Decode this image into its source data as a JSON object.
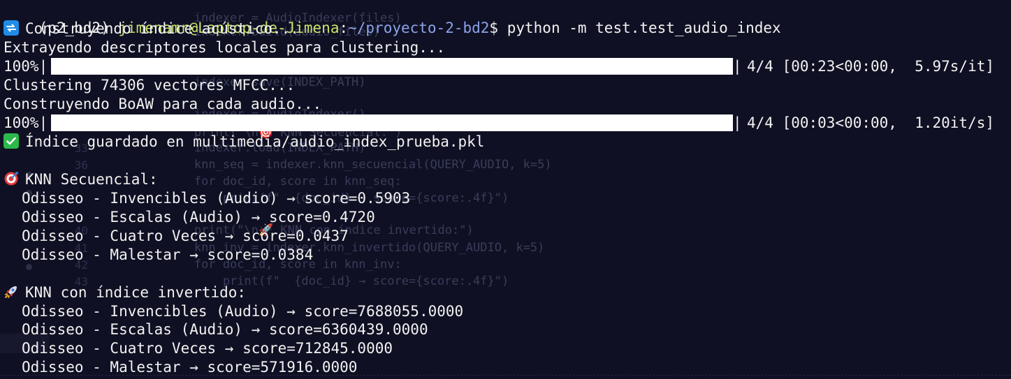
{
  "prompt": {
    "env": "(p2_bd2)",
    "user_host": "jimenamr@Laptop-de-Jimena",
    "colon": ":",
    "path": "~/proyecto-2-bd2",
    "dollar": "$",
    "command": "python -m test.test_audio_index"
  },
  "output": {
    "building_icon": "arrows-cycle-icon",
    "building_text": "Construyendo índice acústico...",
    "extracting_text": "Extrayendo descriptores locales para clustering...",
    "progress_1": {
      "percent_label": "100%|",
      "fraction": 1.0,
      "end_bar": "|",
      "stats": "4/4 [00:23<00:00,  5.97s/it]"
    },
    "clustering_text": "Clustering 74306 vectores MFCC...",
    "boaw_text": "Construyendo BoAW para cada audio...",
    "progress_2": {
      "percent_label": "100%|",
      "fraction": 1.0,
      "end_bar": "|",
      "stats": "4/4 [00:03<00:00,  1.20it/s]"
    },
    "saved_icon": "check-mark-icon",
    "saved_text": "Índice guardado en multimedia/audio_index_prueba.pkl",
    "knn_seq_icon": "target-icon",
    "knn_seq_title": "KNN Secuencial:",
    "knn_seq_results": [
      "Odisseo - Invencibles (Audio) → score=0.5903",
      "Odisseo - Escalas (Audio) → score=0.4720",
      "Odisseo - Cuatro Veces → score=0.0437",
      "Odisseo - Malestar → score=0.0384"
    ],
    "knn_inv_icon": "rocket-icon",
    "knn_inv_title": "KNN con índice invertido:",
    "knn_inv_results": [
      "Odisseo - Invencibles (Audio) → score=7688055.0000",
      "Odisseo - Escalas (Audio) → score=6360439.0000",
      "Odisseo - Cuatro Veces → score=712845.0000",
      "Odisseo - Malestar → score=571916.0000"
    ]
  },
  "ghost": {
    "lines": [
      {
        "num": "",
        "text": "        indexer = AudioIndexer(files)"
      },
      {
        "num": "",
        "text": "        indexer.build(audio_files)"
      },
      {
        "num": "",
        "text": "        indexer.save(INDEX_PATH)"
      },
      {
        "num": "",
        "text": "        indexer = AudioIndexer()"
      },
      {
        "num": "",
        "text": "        print(\"\\n🎯 KNN Secuencial:\")"
      },
      {
        "num": "33",
        "text": "        indexer.load(INDEX_PATH)"
      },
      {
        "num": "36",
        "text": "        knn_seq = indexer.knn_secuencial(QUERY_AUDIO, k=5)"
      },
      {
        "num": "",
        "text": "        for doc_id, score in knn_seq:"
      },
      {
        "num": "",
        "text": "            print(f\"  {doc_id} → score={score:.4f}\")"
      },
      {
        "num": "40",
        "text": "        print(\"\\n🚀 KNN con índice invertido:\")"
      },
      {
        "num": "41",
        "text": "        knn_inv = indexer.knn_invertido(QUERY_AUDIO, k=5)"
      },
      {
        "num": "42",
        "text": "        for doc_id, score in knn_inv:"
      },
      {
        "num": "43",
        "text": "            print(f\"  {doc_id} → score={score:.4f}\")"
      }
    ]
  },
  "colors": {
    "background": "#0f1023",
    "text": "#f2f2f2",
    "user_host": "#c9e36b",
    "path": "#8ba4e8",
    "progress_fill": "#ffffff"
  }
}
